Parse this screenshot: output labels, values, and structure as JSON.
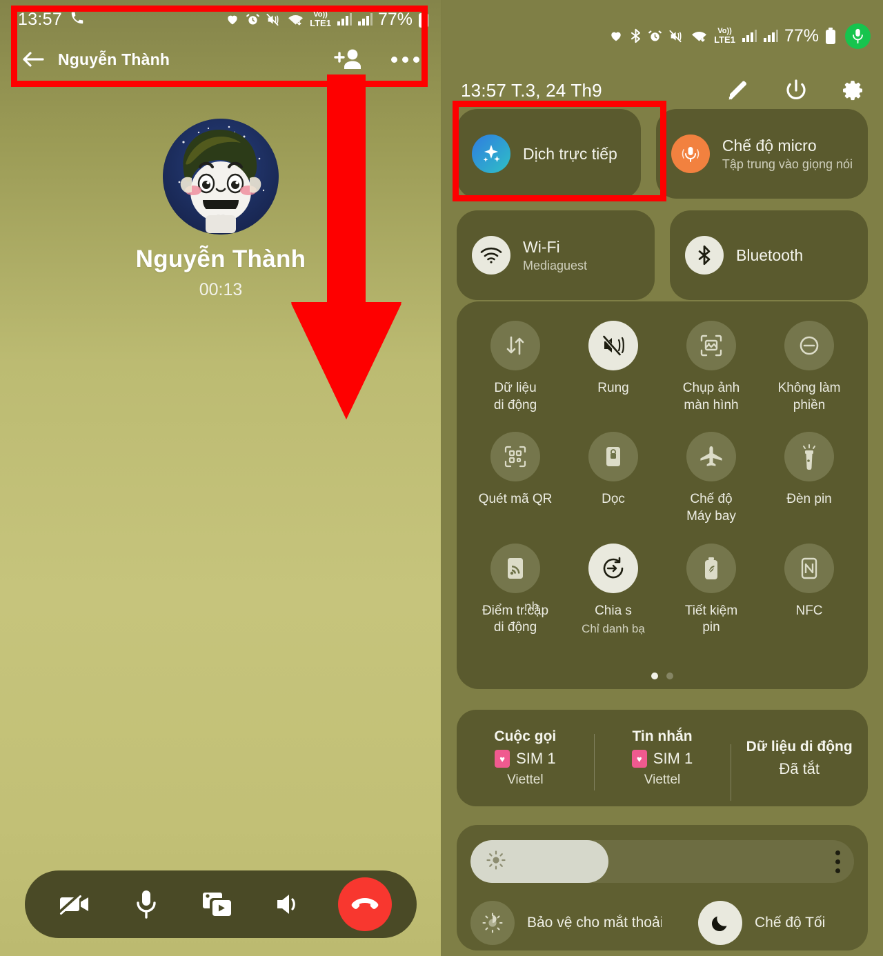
{
  "left_phone": {
    "status_bar": {
      "time": "13:57",
      "call_icon": "phone-icon",
      "icons": [
        "heart-icon",
        "alarm-icon",
        "mute-vibrate-icon",
        "wifi-icon",
        "volte-icon",
        "signal-sim1-icon",
        "signal-sim2-icon"
      ],
      "battery_percent": "77%",
      "volte_label": "LTE1"
    },
    "app_bar": {
      "back_icon": "back-arrow-icon",
      "title": "Nguyễn Thành",
      "add_person_icon": "add-person-icon",
      "more_icon": "more-options-icon"
    },
    "call": {
      "peer_name": "Nguyễn Thành",
      "duration": "00:13",
      "avatar_alt": "cartoon-avatar"
    },
    "dock": {
      "buttons": [
        {
          "name": "video-off-button",
          "icon": "video-camera-off-icon"
        },
        {
          "name": "microphone-button",
          "icon": "microphone-icon"
        },
        {
          "name": "share-media-button",
          "icon": "share-media-icon"
        },
        {
          "name": "speaker-button",
          "icon": "speaker-icon"
        }
      ],
      "end_call": {
        "name": "end-call-button",
        "icon": "end-call-icon",
        "color": "#f8372f"
      }
    }
  },
  "right_phone": {
    "status_bar": {
      "icons": [
        "heart-icon",
        "bluetooth-icon",
        "alarm-icon",
        "mute-vibrate-icon",
        "wifi-icon",
        "volte-icon",
        "signal-sim1-icon",
        "signal-sim2-icon"
      ],
      "battery_percent": "77%",
      "volte_label": "LTE1",
      "mic_chip_icon": "microphone-active-icon",
      "mic_chip_color": "#16c44e"
    },
    "header": {
      "datetime": "13:57  T.3, 24 Th9",
      "edit_icon": "edit-pencil-icon",
      "power_icon": "power-icon",
      "settings_icon": "gear-icon"
    },
    "big_tiles": [
      {
        "name": "tile-live-translate",
        "title": "Dịch trực tiếp",
        "subtitle": "",
        "icon": "sparkle-icon",
        "icon_color": "#2f8ee0",
        "highlighted": true
      },
      {
        "name": "tile-mic-mode",
        "title": "Chế độ micro",
        "subtitle": "Tập trung vào giọng nói",
        "icon": "microphone-icon",
        "icon_color": "#f2813f",
        "highlighted": false
      },
      {
        "name": "tile-wifi",
        "title": "Wi-Fi",
        "subtitle": "Mediaguest",
        "icon": "wifi-icon",
        "icon_color": "#e9e9de",
        "highlighted": false
      },
      {
        "name": "tile-bluetooth",
        "title": "Bluetooth",
        "subtitle": "",
        "icon": "bluetooth-icon",
        "icon_color": "#e9e9de",
        "highlighted": false
      }
    ],
    "quick_grid": [
      {
        "name": "qs-mobile-data",
        "label": "Dữ liệu\ndi động",
        "icon": "data-transfer-icon",
        "active": false,
        "sub": ""
      },
      {
        "name": "qs-vibrate",
        "label": "Rung",
        "icon": "mute-vibrate-icon",
        "active": true,
        "sub": ""
      },
      {
        "name": "qs-screenshot",
        "label": "Chụp ảnh\nmàn hình",
        "icon": "screenshot-icon",
        "active": false,
        "sub": ""
      },
      {
        "name": "qs-do-not-disturb",
        "label": "Không làm\nphiền",
        "icon": "dnd-minus-icon",
        "active": false,
        "sub": ""
      },
      {
        "name": "qs-qr-scan",
        "label": "Quét mã QR",
        "icon": "qr-code-icon",
        "active": false,
        "sub": ""
      },
      {
        "name": "qs-rotation-lock",
        "label": "Dọc",
        "icon": "rotation-lock-icon",
        "active": false,
        "sub": ""
      },
      {
        "name": "qs-airplane-mode",
        "label": "Chế độ\nMáy bay",
        "icon": "airplane-icon",
        "active": false,
        "sub": ""
      },
      {
        "name": "qs-flashlight",
        "label": "Đèn pin",
        "icon": "flashlight-icon",
        "active": false,
        "sub": ""
      },
      {
        "name": "qs-hotspot",
        "label": "Điểm tr.cập\ndi động",
        "icon": "hotspot-icon",
        "active": false,
        "sub": ""
      },
      {
        "name": "qs-quick-share",
        "label": "Chia s",
        "icon": "quick-share-icon",
        "active": true,
        "sub": "Chỉ danh bạ",
        "ghost_left": "nh"
      },
      {
        "name": "qs-power-saving",
        "label": "Tiết kiệm\npin",
        "icon": "battery-leaf-icon",
        "active": false,
        "sub": ""
      },
      {
        "name": "qs-nfc",
        "label": "NFC",
        "icon": "nfc-icon",
        "active": false,
        "sub": ""
      }
    ],
    "page_indicator": {
      "total": 2,
      "current": 1
    },
    "sim_panel": [
      {
        "name": "sim-calls",
        "heading": "Cuộc gọi",
        "value": "SIM 1",
        "operator": "Viettel",
        "badge": true
      },
      {
        "name": "sim-messages",
        "heading": "Tin nhắn",
        "value": "SIM 1",
        "operator": "Viettel",
        "badge": true
      },
      {
        "name": "sim-mobile-data",
        "heading": "Dữ liệu di động",
        "value": "Đã tắt",
        "operator": "",
        "badge": false
      }
    ],
    "brightness": {
      "name": "brightness-slider",
      "level_percent": 36,
      "sun_icon": "brightness-sun-icon",
      "menu_icon": "more-vertical-icon"
    },
    "bottom_toggles": [
      {
        "name": "toggle-eye-comfort",
        "label": "Bảo vệ cho mắt thoải ma",
        "icon": "eye-comfort-sun-icon",
        "active": false
      },
      {
        "name": "toggle-dark-mode",
        "label": "Chế độ Tối",
        "icon": "moon-icon",
        "active": true
      }
    ]
  },
  "annotations": {
    "highlight_color": "#fe0000",
    "boxes": [
      {
        "name": "highlight-left-header",
        "target": "left phone app bar + status bar"
      },
      {
        "name": "highlight-live-translate",
        "target": "Dịch trực tiếp tile"
      }
    ],
    "arrow": {
      "name": "instruction-arrow",
      "direction": "down",
      "color": "#fe0000"
    }
  }
}
